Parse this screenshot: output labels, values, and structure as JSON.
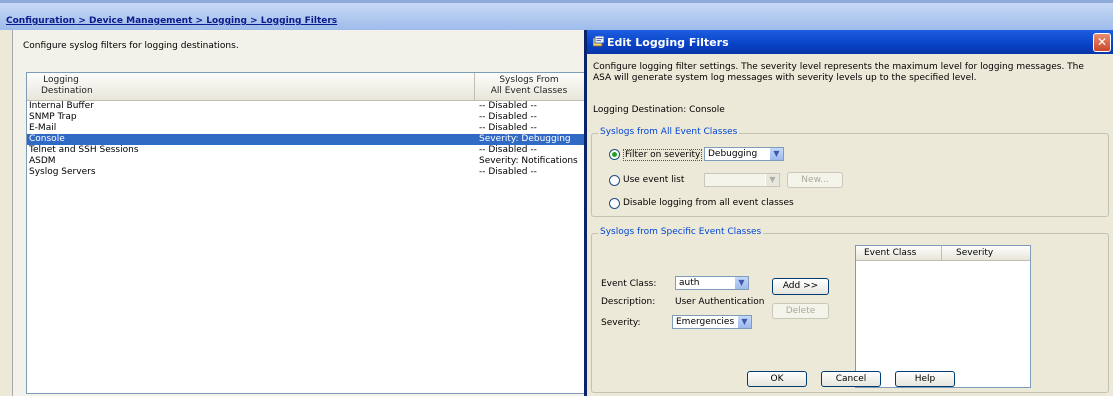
{
  "breadcrumb": [
    "Configuration",
    "Device Management",
    "Logging",
    "Logging Filters"
  ],
  "breadcrumb_sep": " > ",
  "left": {
    "description": "Configure syslog filters for logging destinations.",
    "columns": [
      "Logging\nDestination",
      "Syslogs From\nAll Event Classes"
    ],
    "rows": [
      {
        "destination": "Internal Buffer",
        "syslogs": "-- Disabled --"
      },
      {
        "destination": "SNMP Trap",
        "syslogs": "-- Disabled --"
      },
      {
        "destination": "E-Mail",
        "syslogs": "-- Disabled --"
      },
      {
        "destination": "Console",
        "syslogs": "Severity: Debugging",
        "selected": true
      },
      {
        "destination": "Telnet and SSH Sessions",
        "syslogs": "-- Disabled --"
      },
      {
        "destination": "ASDM",
        "syslogs": "Severity: Notifications"
      },
      {
        "destination": "Syslog Servers",
        "syslogs": "-- Disabled --"
      }
    ]
  },
  "dialog": {
    "title": "Edit Logging Filters",
    "close": "✕",
    "description": "Configure logging filter settings. The severity level represents the maximum level for logging messages. The ASA will generate system log messages with severity levels up to the specified level.",
    "destination_label": "Logging Destination:  Console",
    "all_classes": {
      "label": "Syslogs from All Event Classes",
      "filter_on_severity": "Filter on severity",
      "severity_value": "Debugging",
      "use_event_list": "Use event list",
      "event_list_value": "",
      "new_button": "New...",
      "disable_logging": "Disable logging from all event classes"
    },
    "specific_classes": {
      "label": "Syslogs from Specific Event Classes",
      "event_class_label": "Event Class:",
      "event_class_value": "auth",
      "description_label": "Description:",
      "description_value": "User Authentication",
      "severity_label": "Severity:",
      "severity_value": "Emergencies",
      "add_button": "Add >>",
      "delete_button": "Delete",
      "table_columns": [
        "Event Class",
        "Severity"
      ]
    },
    "buttons": {
      "ok": "OK",
      "cancel": "Cancel",
      "help": "Help"
    }
  },
  "icons": {
    "dialog": "dialog-icon",
    "dropdown": "chevron-down-icon"
  },
  "colors": {
    "titlebar": "#0842C6",
    "selection": "#316AC5",
    "group_label": "#0046D5",
    "breadcrumb": "#0A1C8C"
  }
}
